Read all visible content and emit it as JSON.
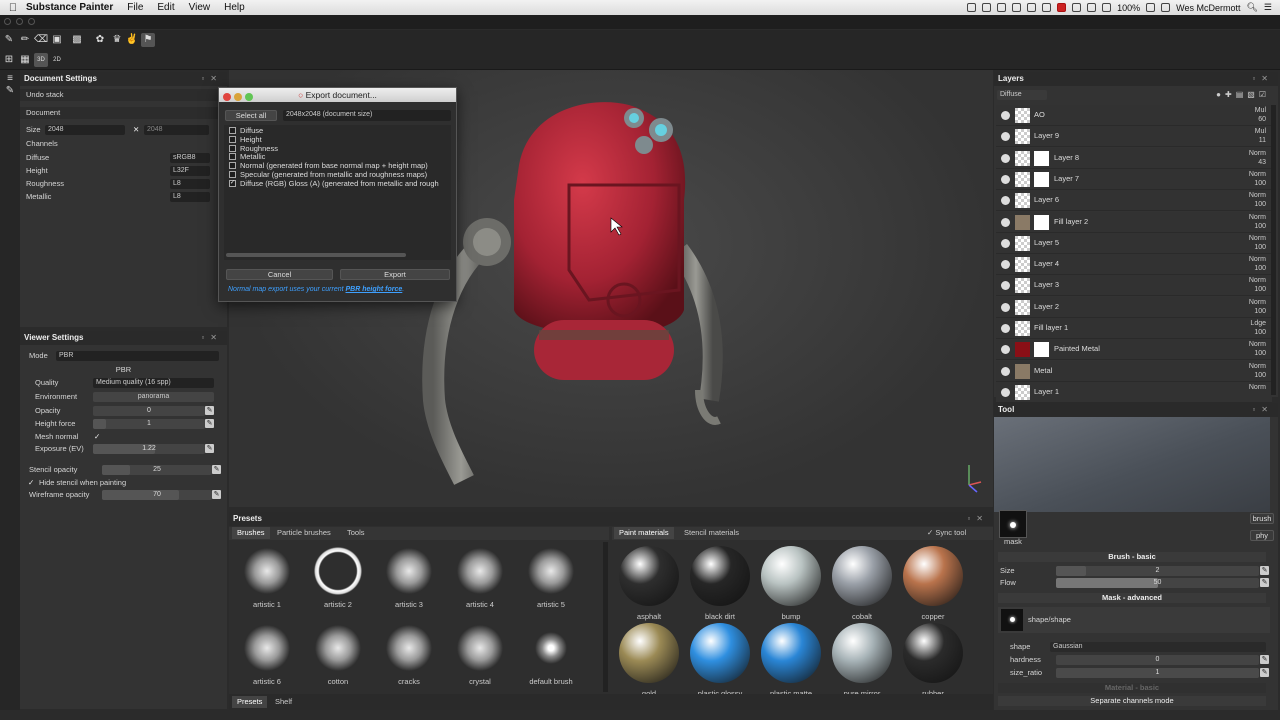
{
  "menubar": {
    "app_name": "Substance Painter",
    "items": [
      "File",
      "Edit",
      "View",
      "Help"
    ],
    "battery": "100%",
    "user": "Wes McDermott"
  },
  "document_settings": {
    "title": "Document Settings",
    "undo_stack": "Undo stack",
    "document_label": "Document",
    "size_label": "Size",
    "size_value": "2048",
    "size_value2": "2048",
    "channels_label": "Channels",
    "channels": [
      {
        "name": "Diffuse",
        "format": "sRGB8"
      },
      {
        "name": "Height",
        "format": "L32F"
      },
      {
        "name": "Roughness",
        "format": "L8"
      },
      {
        "name": "Metallic",
        "format": "L8"
      }
    ]
  },
  "export_dialog": {
    "title": "Export document...",
    "select_all": "Select all",
    "size_option": "2048x2048 (document size)",
    "options": [
      {
        "label": "Diffuse",
        "checked": false
      },
      {
        "label": "Height",
        "checked": false
      },
      {
        "label": "Roughness",
        "checked": false
      },
      {
        "label": "Metallic",
        "checked": false
      },
      {
        "label": "Normal (generated from base normal map + height map)",
        "checked": false
      },
      {
        "label": "Specular (generated from metallic and roughness maps)",
        "checked": false
      },
      {
        "label": "Diffuse (RGB) Gloss (A) (generated from metallic and rough",
        "checked": true
      }
    ],
    "cancel": "Cancel",
    "export": "Export",
    "note_prefix": "Normal map export uses your current ",
    "note_link": "PBR height force",
    "note_suffix": "."
  },
  "viewer_settings": {
    "title": "Viewer Settings",
    "mode_label": "Mode",
    "mode_value": "PBR",
    "pbr_header": "PBR",
    "quality_label": "Quality",
    "quality_value": "Medium quality (16 spp)",
    "environment_label": "Environment",
    "environment_value": "panorama",
    "opacity_label": "Opacity",
    "opacity_value": "0",
    "height_force_label": "Height force",
    "height_force_value": "1",
    "mesh_normal_label": "Mesh normal",
    "exposure_label": "Exposure (EV)",
    "exposure_value": "1.22",
    "stencil_opacity_label": "Stencil opacity",
    "stencil_opacity_value": "25",
    "hide_stencil_label": "Hide stencil when painting",
    "wireframe_label": "Wireframe opacity",
    "wireframe_value": "70"
  },
  "layers": {
    "title": "Layers",
    "channel": "Diffuse",
    "items": [
      {
        "name": "AO",
        "blend": "Mul",
        "opacity": "60",
        "shape": false
      },
      {
        "name": "Layer 9",
        "blend": "Mul",
        "opacity": "11",
        "shape": false
      },
      {
        "name": "Layer 8",
        "blend": "Norm",
        "opacity": "43",
        "shape": true
      },
      {
        "name": "Layer 7",
        "blend": "Norm",
        "opacity": "100",
        "shape": true
      },
      {
        "name": "Layer 6",
        "blend": "Norm",
        "opacity": "100",
        "shape": false
      },
      {
        "name": "Fill layer 2",
        "blend": "Norm",
        "opacity": "100",
        "shape": true
      },
      {
        "name": "Layer 5",
        "blend": "Norm",
        "opacity": "100",
        "shape": false
      },
      {
        "name": "Layer 4",
        "blend": "Norm",
        "opacity": "100",
        "shape": false
      },
      {
        "name": "Layer 3",
        "blend": "Norm",
        "opacity": "100",
        "shape": false
      },
      {
        "name": "Layer 2",
        "blend": "Norm",
        "opacity": "100",
        "shape": false
      },
      {
        "name": "Fill layer 1",
        "blend": "Ldge",
        "opacity": "100",
        "shape": false
      },
      {
        "name": "Painted Metal",
        "blend": "Norm",
        "opacity": "100",
        "shape": true
      },
      {
        "name": "Metal",
        "blend": "Norm",
        "opacity": "100",
        "shape": false
      },
      {
        "name": "Layer 1",
        "blend": "Norm",
        "opacity": "",
        "shape": false
      }
    ]
  },
  "tool": {
    "title": "Tool",
    "mask_label": "mask",
    "brush_btn": "brush",
    "phy_btn": "phy",
    "brush_basic": "Brush - basic",
    "size_label": "Size",
    "size_value": "2",
    "flow_label": "Flow",
    "flow_value": "50",
    "mask_advanced": "Mask - advanced",
    "shape_name": "shape/shape",
    "shape_label": "shape",
    "shape_value": "Gaussian",
    "hardness_label": "hardness",
    "hardness_value": "0",
    "size_ratio_label": "size_ratio",
    "size_ratio_value": "1",
    "material_basic": "Material - basic",
    "separate_channels": "Separate channels mode"
  },
  "presets": {
    "title": "Presets",
    "tabs": [
      "Brushes",
      "Particle brushes",
      "Tools"
    ],
    "mat_tabs": [
      "Paint materials",
      "Stencil materials"
    ],
    "sync_tool": "Sync tool",
    "bottom_tabs": [
      "Presets",
      "Shelf"
    ],
    "brushes": [
      "artistic 1",
      "artistic 2",
      "artistic 3",
      "artistic 4",
      "artistic 5",
      "artistic 6",
      "cotton",
      "cracks",
      "crystal",
      "default brush"
    ],
    "materials": [
      {
        "name": "asphalt",
        "color": "#2e2e2e"
      },
      {
        "name": "black dirt",
        "color": "#262626"
      },
      {
        "name": "bump",
        "color": "#b9c3c2"
      },
      {
        "name": "cobalt",
        "color": "#9aa0a8"
      },
      {
        "name": "copper",
        "color": "#b9734c"
      },
      {
        "name": "gold",
        "color": "#9b8a55"
      },
      {
        "name": "plastic glossy",
        "color": "#2f8fe0"
      },
      {
        "name": "plastic matte",
        "color": "#2a86d6"
      },
      {
        "name": "pure mirror",
        "color": "#a7b3b7"
      },
      {
        "name": "rubber",
        "color": "#2b2b2b"
      }
    ]
  },
  "colors": {
    "accent_link": "#3ea0ff",
    "robot_red": "#b5283a",
    "painted_metal_swatch": "#8a0f16",
    "metal_swatch": "#8a7a66"
  }
}
